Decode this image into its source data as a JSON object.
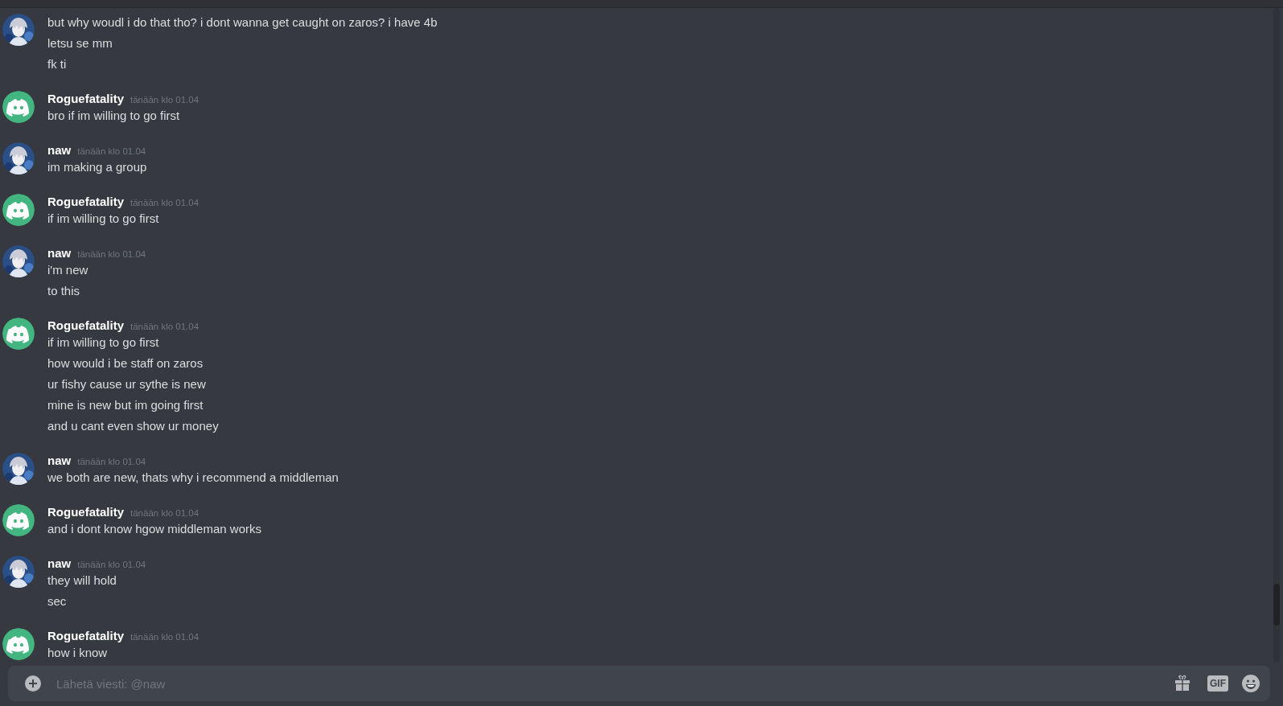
{
  "messages": [
    {
      "kind": "custom",
      "messages": [
        "but why woudl i do that tho? i dont wanna get caught on zaros? i have 4b",
        "letsu se mm",
        "fk ti"
      ]
    },
    {
      "kind": "default",
      "author": "Roguefatality",
      "time": "tänään klo 01.04",
      "messages": [
        "bro if im willing to go first"
      ]
    },
    {
      "kind": "custom",
      "author": "naw",
      "time": "tänään klo 01.04",
      "messages": [
        "im making a group"
      ]
    },
    {
      "kind": "default",
      "author": "Roguefatality",
      "time": "tänään klo 01.04",
      "messages": [
        "if im willing to go first"
      ]
    },
    {
      "kind": "custom",
      "author": "naw",
      "time": "tänään klo 01.04",
      "messages": [
        "i'm new",
        "to this"
      ]
    },
    {
      "kind": "default",
      "author": "Roguefatality",
      "time": "tänään klo 01.04",
      "messages": [
        "if im willing to go first",
        "how would i be staff on zaros",
        "ur fishy cause ur sythe is new",
        "mine is new but im going first",
        "and u cant even show ur money"
      ]
    },
    {
      "kind": "custom",
      "author": "naw",
      "time": "tänään klo 01.04",
      "messages": [
        "we both are new, thats why i recommend a middleman"
      ]
    },
    {
      "kind": "default",
      "author": "Roguefatality",
      "time": "tänään klo 01.04",
      "messages": [
        "and i dont know hgow middleman works"
      ]
    },
    {
      "kind": "custom",
      "author": "naw",
      "time": "tänään klo 01.04",
      "messages": [
        "they will hold",
        "sec"
      ]
    },
    {
      "kind": "default",
      "author": "Roguefatality",
      "time": "tänään klo 01.04",
      "messages": [
        "how i know"
      ]
    }
  ],
  "composer": {
    "placeholder": "Lähetä viesti: @naw",
    "gif_label": "GIF"
  }
}
